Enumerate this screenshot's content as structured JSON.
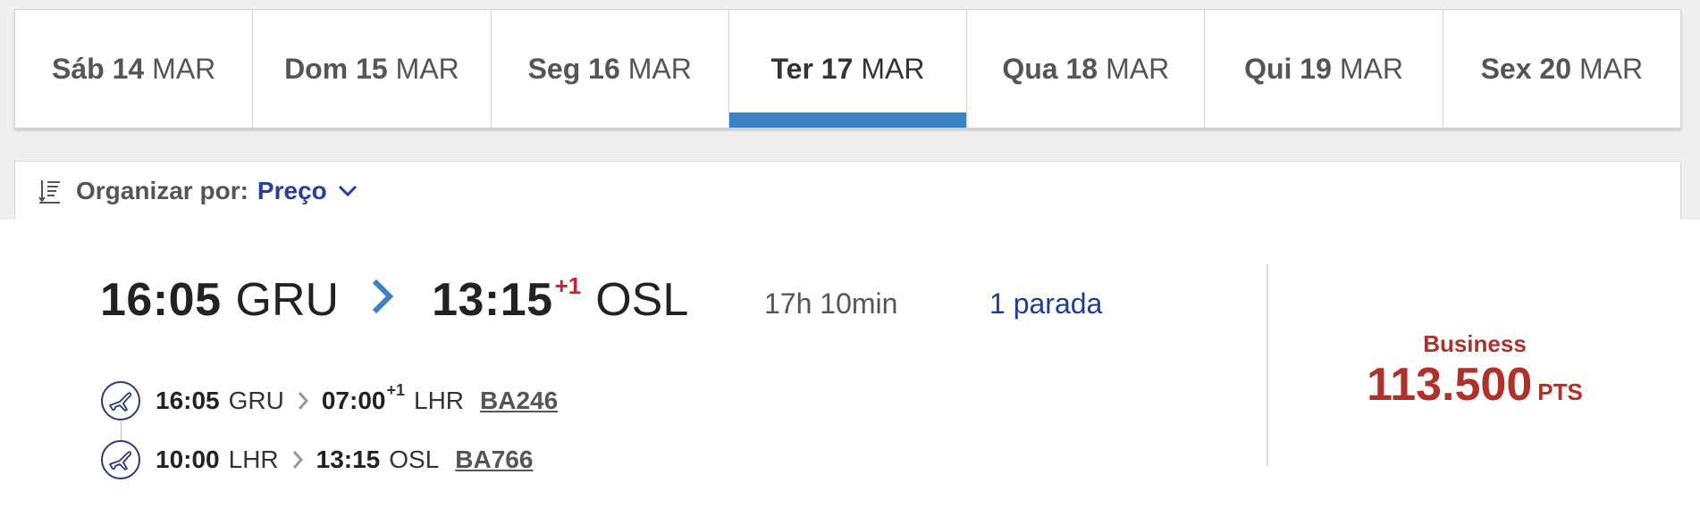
{
  "date_tabs": [
    {
      "weekday": "Sáb 14",
      "month": "MAR",
      "active": false
    },
    {
      "weekday": "Dom 15",
      "month": "MAR",
      "active": false
    },
    {
      "weekday": "Seg 16",
      "month": "MAR",
      "active": false
    },
    {
      "weekday": "Ter 17",
      "month": "MAR",
      "active": true
    },
    {
      "weekday": "Qua 18",
      "month": "MAR",
      "active": false
    },
    {
      "weekday": "Qui 19",
      "month": "MAR",
      "active": false
    },
    {
      "weekday": "Sex 20",
      "month": "MAR",
      "active": false
    }
  ],
  "sort": {
    "icon": "sort-icon",
    "label": "Organizar por:",
    "value": "Preço"
  },
  "flight": {
    "depart_time": "16:05",
    "depart_code": "GRU",
    "arrive_time": "13:15",
    "arrive_day_offset": "+1",
    "arrive_code": "OSL",
    "duration": "17h 10min",
    "stops": "1 parada",
    "segments": [
      {
        "dep_time": "16:05",
        "dep_code": "GRU",
        "arr_time": "07:00",
        "arr_day_offset": "+1",
        "arr_code": "LHR",
        "flight_no": "BA246"
      },
      {
        "dep_time": "10:00",
        "dep_code": "LHR",
        "arr_time": "13:15",
        "arr_day_offset": "",
        "arr_code": "OSL",
        "flight_no": "BA766"
      }
    ],
    "cabin": "Business",
    "price": "113.500",
    "price_unit": "PTS"
  },
  "colors": {
    "accent_blue": "#3a82c4",
    "link_blue": "#283e9c",
    "price_red": "#b0302a",
    "plus_red": "#c0282d"
  }
}
